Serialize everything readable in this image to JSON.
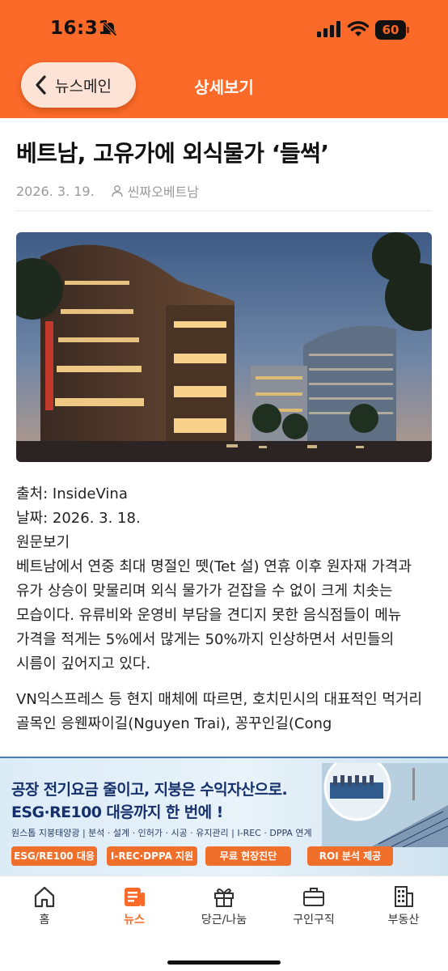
{
  "status_bar": {
    "time": "16:31",
    "battery": "60"
  },
  "header": {
    "back_label": "뉴스메인",
    "title": "상세보기"
  },
  "article": {
    "headline": "베트남, 고유가에 외식물가 ‘들썩’",
    "date": "2026. 3. 19.",
    "author": "씬짜오베트남",
    "source_line": "출처: InsideVina",
    "date_line": "날짜: 2026. 3. 18.",
    "original_link": "원문보기",
    "paragraph1": "베트남에서 연중 최대 명절인 뗏(Tet 설) 연휴 이후 원자재 가격과 유가 상승이 맞물리며 외식 물가가 걷잡을 수 없이 크게 치솟는 모습이다. 유류비와 운영비 부담을 견디지 못한 음식점들이 메뉴 가격을 적게는 5%에서 많게는 50%까지 인상하면서 서민들의 시름이 깊어지고 있다.",
    "paragraph2": "VN익스프레스 등 현지 매체에 따르면, 호치민시의 대표적인 먹거리 골목인 응웬짜이길(Nguyen Trai), 꽁꾸인길(Cong"
  },
  "ad": {
    "line1": "공장 전기요금 줄이고, 지붕은 수익자산으로.",
    "line2": "ESG·RE100 대응까지 한 번에 !",
    "sub": "원스톱 지붕태양광 | 분석 · 설계 · 인허가 · 시공 · 유지관리 | I-REC · DPPA 연계",
    "chips": [
      "ESG/RE100 대응",
      "I-REC·DPPA 지원",
      "무료 현장진단",
      "ROI 분석 제공"
    ]
  },
  "tabs": [
    {
      "label": "홈",
      "icon": "home-icon"
    },
    {
      "label": "뉴스",
      "icon": "news-icon"
    },
    {
      "label": "당근/나눔",
      "icon": "gift-icon"
    },
    {
      "label": "구인구직",
      "icon": "briefcase-icon"
    },
    {
      "label": "부동산",
      "icon": "building-icon"
    }
  ],
  "colors": {
    "brand": "#fb6a29",
    "ad_navy": "#16306b",
    "ad_chip": "#f06f2b"
  }
}
